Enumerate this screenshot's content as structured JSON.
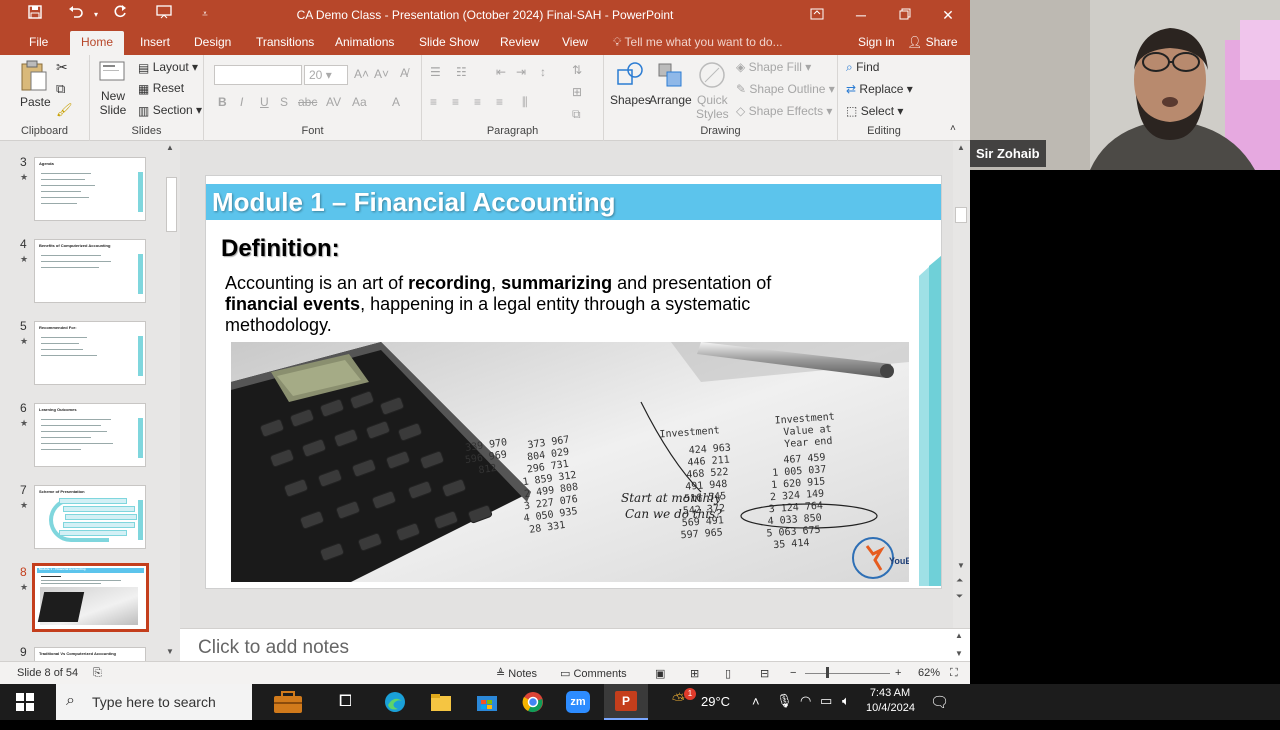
{
  "window": {
    "title": "CA Demo Class - Presentation (October 2024) Final-SAH - PowerPoint",
    "accent": "#b7472a"
  },
  "tabs": [
    "File",
    "Home",
    "Insert",
    "Design",
    "Transitions",
    "Animations",
    "Slide Show",
    "Review",
    "View"
  ],
  "tell_me": "Tell me what you want to do...",
  "sign_in": "Sign in",
  "share": "Share",
  "ribbon": {
    "clipboard": {
      "paste": "Paste",
      "label": "Clipboard"
    },
    "slides": {
      "new_slide": "New",
      "new_slide2": "Slide",
      "layout": "Layout",
      "reset": "Reset",
      "section": "Section",
      "label": "Slides"
    },
    "font": {
      "size": "20",
      "label": "Font"
    },
    "paragraph": {
      "label": "Paragraph"
    },
    "drawing": {
      "shapes": "Shapes",
      "arrange": "Arrange",
      "quick": "Quick",
      "styles": "Styles",
      "fill": "Shape Fill",
      "outline": "Shape Outline",
      "effects": "Shape Effects",
      "label": "Drawing"
    },
    "editing": {
      "find": "Find",
      "replace": "Replace",
      "select": "Select",
      "label": "Editing"
    }
  },
  "thumbnails": [
    {
      "num": "3",
      "title": "Agenda"
    },
    {
      "num": "4",
      "title": "Benefits of Computerized Accounting"
    },
    {
      "num": "5",
      "title": "Recommended For:"
    },
    {
      "num": "6",
      "title": "Learning Outcomes"
    },
    {
      "num": "7",
      "title": "Scheme of Presentation"
    },
    {
      "num": "8",
      "title": "Module 1 – Financial Accounting"
    },
    {
      "num": "9",
      "title": "Traditional Vs Computerized Accounting"
    }
  ],
  "slide": {
    "module_title": "Module 1 – Financial Accounting",
    "definition": "Definition:",
    "p1": "Accounting is an art of ",
    "b1": "recording",
    "p2": ", ",
    "b2": "summarizing",
    "p3": " and presentation of ",
    "b3": "financial events",
    "p4": ", happening in a legal entity through a systematic methodology.",
    "logo": "YouExcel",
    "photo_text": {
      "c1": [
        "373 967",
        "804 029",
        "296 731",
        "1 859 312",
        "2 499 808",
        "3 227 076",
        "4 050 935",
        "28 331"
      ],
      "c1b": [
        "339 970",
        "596 969",
        "812"
      ],
      "c2": [
        "424 963",
        "446 211",
        "468 522",
        "491 948",
        "516 545",
        "542 372",
        "569 491",
        "597 965"
      ],
      "c3": [
        "467 459",
        "1 005 037",
        "1 620 915",
        "2 324 149",
        "3 124 764",
        "4 033 850",
        "5 063 675",
        "35 414"
      ],
      "h2": "Investment",
      "h3": [
        "Investment",
        "Value at",
        "Year end"
      ],
      "note1": "Start at monthly",
      "note2": "Can we do this?"
    }
  },
  "notes_placeholder": "Click to add notes",
  "status": {
    "slide_of": "Slide 8 of 54",
    "notes": "Notes",
    "comments": "Comments",
    "zoom": "62%"
  },
  "video": {
    "participant": "Sir Zohaib"
  },
  "taskbar": {
    "search_placeholder": "Type here to search",
    "zoom_app": "zm",
    "temperature": "29°C",
    "time": "7:43 AM",
    "date": "10/4/2024",
    "weather_badge": "1"
  }
}
